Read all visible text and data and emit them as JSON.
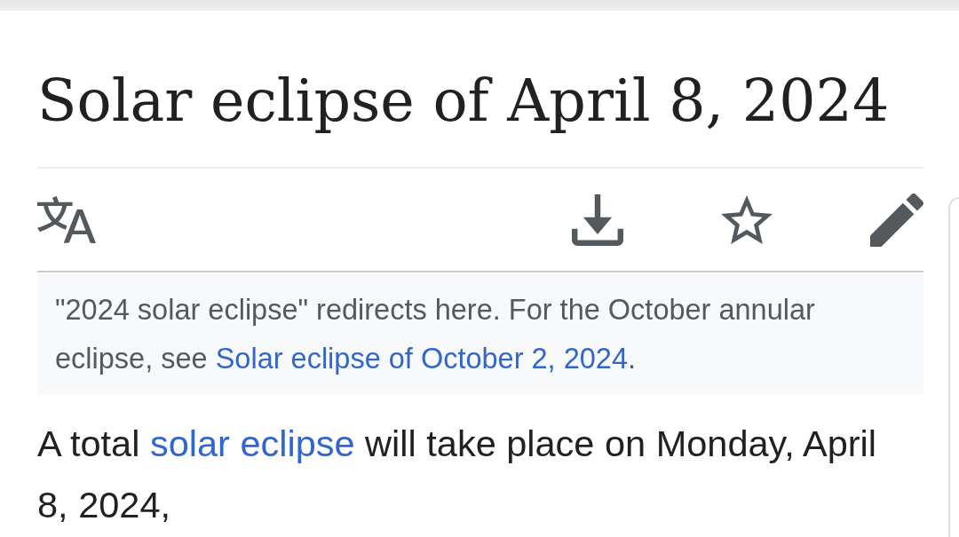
{
  "title": "Solar eclipse of April 8, 2024",
  "toolbar": {
    "actions": [
      {
        "kind": "language"
      },
      {
        "kind": "download"
      },
      {
        "kind": "watch",
        "watched": false
      },
      {
        "kind": "edit"
      }
    ]
  },
  "hatnote": {
    "parts": [
      {
        "kind": "text",
        "text": "\"2024 solar eclipse\" redirects here. For the October annular eclipse, see "
      },
      {
        "kind": "link",
        "text": "Solar eclipse of October 2, 2024"
      },
      {
        "kind": "text",
        "text": "."
      }
    ]
  },
  "paragraph": {
    "parts": [
      {
        "kind": "text",
        "text": "A total "
      },
      {
        "kind": "link",
        "text": "solar eclipse"
      },
      {
        "kind": "text",
        "text": " will take place on Monday, April 8, 2024,"
      }
    ]
  }
}
